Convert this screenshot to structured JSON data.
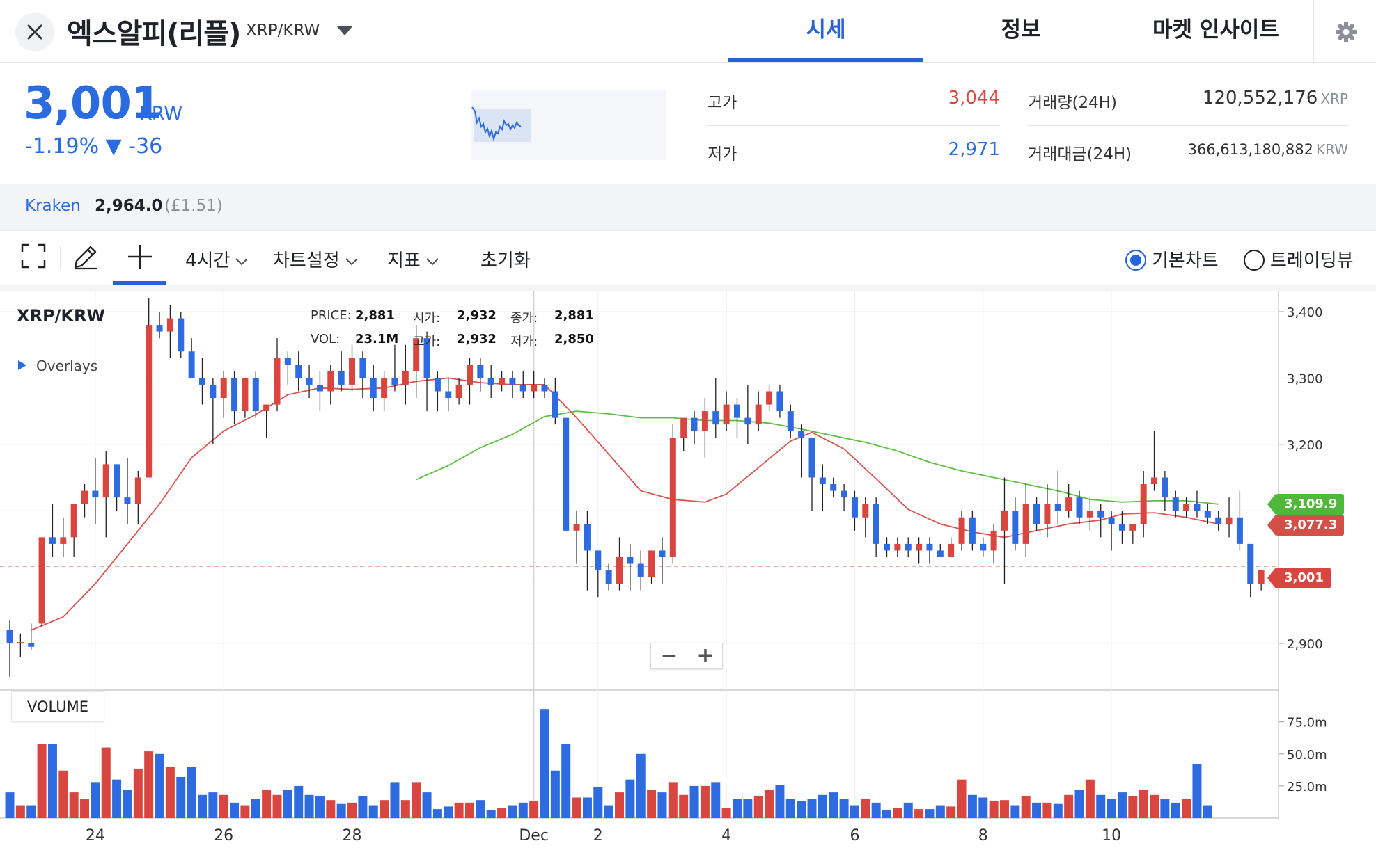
{
  "header": {
    "title": "엑스알피(리플)",
    "pair": "XRP/KRW",
    "tabs": [
      {
        "label": "시세",
        "active": true
      },
      {
        "label": "정보",
        "active": false
      },
      {
        "label": "마켓 인사이트",
        "active": false
      }
    ]
  },
  "price": {
    "current": "3,001",
    "unit": "KRW",
    "change_text": "-1.19% ▼ -36",
    "color": "#2a6be0"
  },
  "stats": {
    "high_label": "고가",
    "high_value": "3,044",
    "low_label": "저가",
    "low_value": "2,971",
    "volume_label": "거래량(24H)",
    "volume_value": "120,552,176",
    "volume_unit": "XRP",
    "amount_label": "거래대금(24H)",
    "amount_value": "366,613,180,882",
    "amount_unit": "KRW"
  },
  "exchange": {
    "name": "Kraken",
    "price": "2,964.0",
    "gbp": "(£1.51)"
  },
  "toolbar": {
    "interval": "4시간",
    "settings": "차트설정",
    "indicators": "지표",
    "reset": "초기화",
    "basic_chart": "기본차트",
    "tradingview": "트레이딩뷰",
    "selected_chart": "basic"
  },
  "chart": {
    "symbol": "XRP/KRW",
    "overlays_label": "Overlays",
    "volume_label": "VOLUME",
    "legend": {
      "price_label": "PRICE:",
      "price": "2,881",
      "vol_label": "VOL:",
      "vol": "23.1M",
      "open_label": "시가:",
      "open": "2,932",
      "high_label": "고가:",
      "high": "2,932",
      "close_label": "종가:",
      "close": "2,881",
      "low_label": "저가:",
      "low": "2,850"
    },
    "tags": {
      "ma_long": "3,109.9",
      "ma_short": "3,077.3",
      "last": "3,001"
    },
    "colors": {
      "up": "#d9453f",
      "down": "#2f6be0",
      "ma_long": "#5cbf3f",
      "ma_short": "#d9534f"
    }
  },
  "chart_data": {
    "type": "candlestick",
    "title": "XRP/KRW",
    "price_ylim": [
      2800,
      3420
    ],
    "price_ticks": [
      "3,400",
      "3,300",
      "3,200",
      "2,900"
    ],
    "price_tick_values": [
      3400,
      3300,
      3200,
      2900
    ],
    "volume_ticks": [
      "75.0m",
      "50.0m",
      "25.0m"
    ],
    "volume_tick_values": [
      75,
      50,
      25
    ],
    "volume_ylim": [
      0,
      90
    ],
    "x_tick_labels": [
      "24",
      "26",
      "28",
      "Dec",
      "2",
      "4",
      "6",
      "8",
      "10"
    ],
    "x_tick_candle_index": [
      8,
      20,
      32,
      49,
      55,
      67,
      79,
      91,
      103
    ],
    "candles": [
      [
        2920,
        2935,
        2850,
        2900
      ],
      [
        2900,
        2915,
        2880,
        2902
      ],
      [
        2900,
        2930,
        2890,
        2895
      ],
      [
        2930,
        3060,
        2925,
        3060
      ],
      [
        3060,
        3110,
        3030,
        3050
      ],
      [
        3050,
        3090,
        3030,
        3060
      ],
      [
        3060,
        3100,
        3030,
        3110
      ],
      [
        3110,
        3140,
        3090,
        3130
      ],
      [
        3130,
        3180,
        3080,
        3120
      ],
      [
        3120,
        3190,
        3060,
        3170
      ],
      [
        3170,
        3170,
        3100,
        3120
      ],
      [
        3120,
        3180,
        3080,
        3110
      ],
      [
        3110,
        3160,
        3080,
        3150
      ],
      [
        3150,
        3420,
        3150,
        3380
      ],
      [
        3380,
        3400,
        3360,
        3370
      ],
      [
        3370,
        3410,
        3330,
        3390
      ],
      [
        3390,
        3400,
        3330,
        3340
      ],
      [
        3340,
        3360,
        3300,
        3300
      ],
      [
        3300,
        3330,
        3260,
        3290
      ],
      [
        3290,
        3300,
        3200,
        3270
      ],
      [
        3270,
        3310,
        3240,
        3300
      ],
      [
        3300,
        3310,
        3230,
        3250
      ],
      [
        3250,
        3300,
        3240,
        3300
      ],
      [
        3300,
        3310,
        3240,
        3250
      ],
      [
        3250,
        3260,
        3210,
        3260
      ],
      [
        3260,
        3360,
        3250,
        3330
      ],
      [
        3330,
        3340,
        3290,
        3320
      ],
      [
        3320,
        3340,
        3280,
        3300
      ],
      [
        3300,
        3320,
        3270,
        3290
      ],
      [
        3290,
        3310,
        3250,
        3280
      ],
      [
        3280,
        3320,
        3260,
        3310
      ],
      [
        3310,
        3340,
        3280,
        3290
      ],
      [
        3290,
        3350,
        3280,
        3330
      ],
      [
        3330,
        3340,
        3270,
        3300
      ],
      [
        3300,
        3320,
        3250,
        3270
      ],
      [
        3270,
        3310,
        3250,
        3300
      ],
      [
        3300,
        3350,
        3280,
        3290
      ],
      [
        3290,
        3350,
        3260,
        3310
      ],
      [
        3310,
        3380,
        3270,
        3360
      ],
      [
        3360,
        3370,
        3250,
        3300
      ],
      [
        3300,
        3310,
        3250,
        3280
      ],
      [
        3280,
        3300,
        3250,
        3270
      ],
      [
        3270,
        3300,
        3260,
        3290
      ],
      [
        3290,
        3330,
        3260,
        3320
      ],
      [
        3320,
        3330,
        3280,
        3300
      ],
      [
        3300,
        3320,
        3270,
        3290
      ],
      [
        3290,
        3310,
        3280,
        3300
      ],
      [
        3300,
        3310,
        3270,
        3290
      ],
      [
        3290,
        3310,
        3270,
        3280
      ],
      [
        3280,
        3310,
        3270,
        3290
      ],
      [
        3290,
        3300,
        3270,
        3280
      ],
      [
        3280,
        3300,
        3230,
        3240
      ],
      [
        3240,
        3240,
        3070,
        3070
      ],
      [
        3070,
        3100,
        3020,
        3080
      ],
      [
        3080,
        3100,
        2980,
        3040
      ],
      [
        3040,
        3040,
        2970,
        3010
      ],
      [
        3010,
        3020,
        2980,
        2990
      ],
      [
        2990,
        3060,
        2980,
        3030
      ],
      [
        3030,
        3050,
        2980,
        3020
      ],
      [
        3020,
        3040,
        2980,
        3000
      ],
      [
        3000,
        3040,
        2990,
        3040
      ],
      [
        3040,
        3060,
        2990,
        3030
      ],
      [
        3030,
        3230,
        3020,
        3210
      ],
      [
        3210,
        3240,
        3190,
        3240
      ],
      [
        3240,
        3250,
        3200,
        3220
      ],
      [
        3220,
        3270,
        3180,
        3250
      ],
      [
        3250,
        3300,
        3210,
        3230
      ],
      [
        3230,
        3280,
        3220,
        3260
      ],
      [
        3260,
        3270,
        3210,
        3240
      ],
      [
        3240,
        3290,
        3200,
        3230
      ],
      [
        3230,
        3280,
        3220,
        3260
      ],
      [
        3260,
        3290,
        3250,
        3280
      ],
      [
        3280,
        3290,
        3240,
        3250
      ],
      [
        3250,
        3260,
        3210,
        3220
      ],
      [
        3220,
        3230,
        3150,
        3210
      ],
      [
        3210,
        3210,
        3100,
        3150
      ],
      [
        3150,
        3170,
        3100,
        3140
      ],
      [
        3140,
        3150,
        3120,
        3130
      ],
      [
        3130,
        3140,
        3100,
        3120
      ],
      [
        3120,
        3130,
        3070,
        3090
      ],
      [
        3090,
        3120,
        3060,
        3110
      ],
      [
        3110,
        3120,
        3030,
        3050
      ],
      [
        3050,
        3060,
        3030,
        3040
      ],
      [
        3040,
        3060,
        3030,
        3050
      ],
      [
        3050,
        3060,
        3030,
        3040
      ],
      [
        3040,
        3060,
        3020,
        3050
      ],
      [
        3050,
        3060,
        3020,
        3040
      ],
      [
        3040,
        3050,
        3030,
        3030
      ],
      [
        3030,
        3060,
        3030,
        3050
      ],
      [
        3050,
        3100,
        3040,
        3090
      ],
      [
        3090,
        3100,
        3040,
        3050
      ],
      [
        3050,
        3060,
        3030,
        3040
      ],
      [
        3040,
        3080,
        3020,
        3070
      ],
      [
        3070,
        3150,
        2990,
        3100
      ],
      [
        3100,
        3120,
        3040,
        3050
      ],
      [
        3050,
        3140,
        3030,
        3110
      ],
      [
        3110,
        3120,
        3070,
        3080
      ],
      [
        3080,
        3140,
        3060,
        3110
      ],
      [
        3110,
        3160,
        3080,
        3100
      ],
      [
        3100,
        3140,
        3090,
        3120
      ],
      [
        3120,
        3130,
        3080,
        3090
      ],
      [
        3090,
        3120,
        3070,
        3100
      ],
      [
        3100,
        3110,
        3060,
        3090
      ],
      [
        3090,
        3100,
        3040,
        3080
      ],
      [
        3080,
        3100,
        3050,
        3070
      ],
      [
        3070,
        3080,
        3050,
        3080
      ],
      [
        3080,
        3160,
        3060,
        3140
      ],
      [
        3140,
        3220,
        3130,
        3150
      ],
      [
        3150,
        3160,
        3100,
        3120
      ],
      [
        3120,
        3130,
        3090,
        3100
      ],
      [
        3100,
        3120,
        3090,
        3110
      ],
      [
        3110,
        3130,
        3090,
        3100
      ],
      [
        3100,
        3110,
        3080,
        3090
      ],
      [
        3090,
        3100,
        3070,
        3080
      ],
      [
        3080,
        3120,
        3060,
        3090
      ],
      [
        3090,
        3130,
        3040,
        3050
      ],
      [
        3050,
        3050,
        2970,
        2990
      ],
      [
        2990,
        3010,
        2980,
        3010
      ]
    ],
    "volumes": [
      20,
      10,
      10,
      58,
      58,
      37,
      20,
      15,
      28,
      55,
      30,
      22,
      38,
      52,
      50,
      40,
      32,
      40,
      18,
      20,
      18,
      12,
      10,
      15,
      22,
      18,
      22,
      25,
      18,
      17,
      14,
      11,
      12,
      17,
      10,
      14,
      28,
      14,
      28,
      20,
      7,
      9,
      12,
      12,
      14,
      6,
      8,
      10,
      12,
      13,
      85,
      37,
      58,
      16,
      16,
      24,
      10,
      20,
      30,
      50,
      22,
      20,
      28,
      18,
      25,
      25,
      28,
      8,
      15,
      15,
      17,
      22,
      26,
      15,
      13,
      15,
      18,
      20,
      15,
      10,
      15,
      12,
      6,
      8,
      12,
      7,
      7,
      10,
      9,
      30,
      18,
      16,
      13,
      14,
      10,
      17,
      12,
      12,
      11,
      18,
      22,
      30,
      18,
      15,
      20,
      17,
      22,
      18,
      15,
      12,
      15,
      42,
      10
    ],
    "ma_short": [
      [
        2,
        2920
      ],
      [
        5,
        2940
      ],
      [
        8,
        2990
      ],
      [
        11,
        3050
      ],
      [
        14,
        3110
      ],
      [
        17,
        3180
      ],
      [
        20,
        3220
      ],
      [
        23,
        3245
      ],
      [
        26,
        3275
      ],
      [
        29,
        3285
      ],
      [
        32,
        3283
      ],
      [
        35,
        3285
      ],
      [
        38,
        3295
      ],
      [
        41,
        3300
      ],
      [
        44,
        3293
      ],
      [
        47,
        3290
      ],
      [
        50,
        3290
      ],
      [
        53,
        3240
      ],
      [
        56,
        3185
      ],
      [
        59,
        3130
      ],
      [
        62,
        3117
      ],
      [
        65,
        3113
      ],
      [
        67,
        3125
      ],
      [
        70,
        3165
      ],
      [
        73,
        3205
      ],
      [
        75,
        3218
      ],
      [
        78,
        3193
      ],
      [
        81,
        3148
      ],
      [
        84,
        3102
      ],
      [
        87,
        3080
      ],
      [
        90,
        3068
      ],
      [
        93,
        3060
      ],
      [
        96,
        3070
      ],
      [
        99,
        3080
      ],
      [
        102,
        3086
      ],
      [
        104,
        3095
      ],
      [
        107,
        3097
      ],
      [
        110,
        3090
      ],
      [
        113,
        3080
      ]
    ],
    "ma_long": [
      [
        38,
        3147
      ],
      [
        41,
        3168
      ],
      [
        44,
        3195
      ],
      [
        47,
        3215
      ],
      [
        50,
        3242
      ],
      [
        53,
        3250
      ],
      [
        56,
        3246
      ],
      [
        59,
        3240
      ],
      [
        62,
        3240
      ],
      [
        65,
        3236
      ],
      [
        68,
        3236
      ],
      [
        71,
        3232
      ],
      [
        74,
        3223
      ],
      [
        77,
        3213
      ],
      [
        80,
        3203
      ],
      [
        83,
        3190
      ],
      [
        86,
        3173
      ],
      [
        89,
        3160
      ],
      [
        92,
        3150
      ],
      [
        95,
        3140
      ],
      [
        98,
        3130
      ],
      [
        101,
        3117
      ],
      [
        104,
        3113
      ],
      [
        107,
        3115
      ],
      [
        110,
        3115
      ],
      [
        113,
        3109.9
      ]
    ]
  }
}
